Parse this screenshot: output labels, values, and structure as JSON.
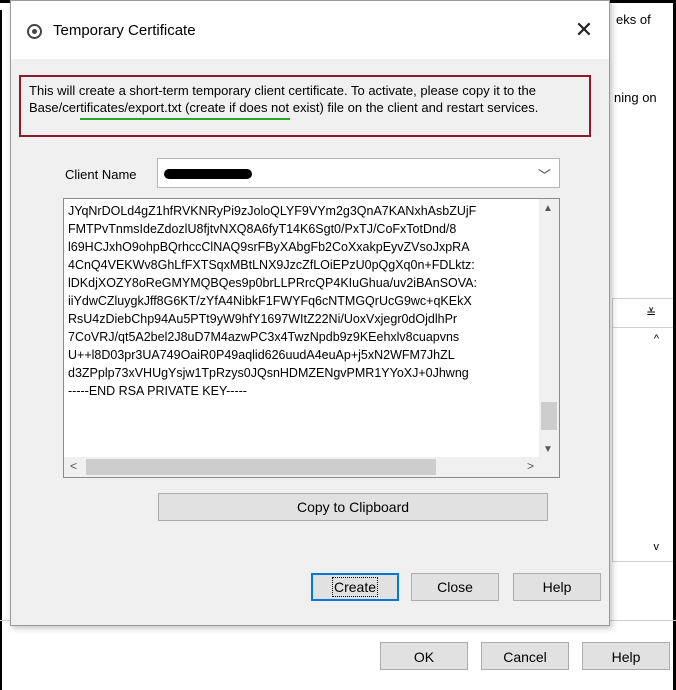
{
  "background_window": {
    "fragments": [
      "eks of",
      "ning on"
    ],
    "buttons": {
      "ok": "OK",
      "cancel": "Cancel",
      "help": "Help"
    }
  },
  "dialog": {
    "title": "Temporary Certificate",
    "close_glyph": "✕",
    "info": {
      "part1": "This will create a short-term temporary client certificate. To activate, please copy it to the ",
      "link": "Base/certificates/export.txt",
      "part2": " (create if does not exist) file on the client and restart services.",
      "border_color": "#8b1a2a",
      "underline_color": "#2aa52a"
    },
    "client_name_label": "Client Name",
    "client_name_value": "[redacted]",
    "key_lines": [
      "JYqNrDOLd4gZ1hfRVKNRyPi9zJoloQLYF9VYm2g3QnA7KANxhAsbZUjF",
      "FMTPvTnmsIdeZdozlU8fjtvNXQ8A6fyT14K6Sgt0/PxTJ/CoFxTotDnd/8",
      "l69HCJxhO9ohpBQrhccClNAQ9srFByXAbgFb2CoXxakpEyvZVsoJxpRA",
      "4CnQ4VEKWv8GhLfFXTSqxMBtLNX9JzcZfLOiEPzU0pQgXq0n+FDLktz:",
      "lDKdjXOZY8oReGMYMQBQes9p0brLLPRrcQP4KIuGhua/uv2iBAnSOVA:",
      "iiYdwCZluygkJff8G6KT/zYfA4NibkF1FWYFq6cNTMGQrUcG9wc+qKEkX",
      "RsU4zDiebChp94Au5PTt9yW9hfY1697WItZ22Ni/UoxVxjegr0dOjdlhPr",
      "7CoVRJ/qt5A2bel2J8uD7M4azwPC3x4TwzNpdb9z9KEehxlv8cuapvns",
      "U++l8D03pr3UA749OaiR0P49aqlid626uudA4euAp+j5xN2WFM7JhZL",
      "d3ZPplp73xVHUgYsjw1TpRzys0JQsnHDMZENgvPMR1YYoXJ+0Jhwng",
      "-----END RSA PRIVATE KEY-----"
    ],
    "copy_button": "Copy to Clipboard",
    "buttons": {
      "create": "Create",
      "close": "Close",
      "help": "Help"
    }
  }
}
